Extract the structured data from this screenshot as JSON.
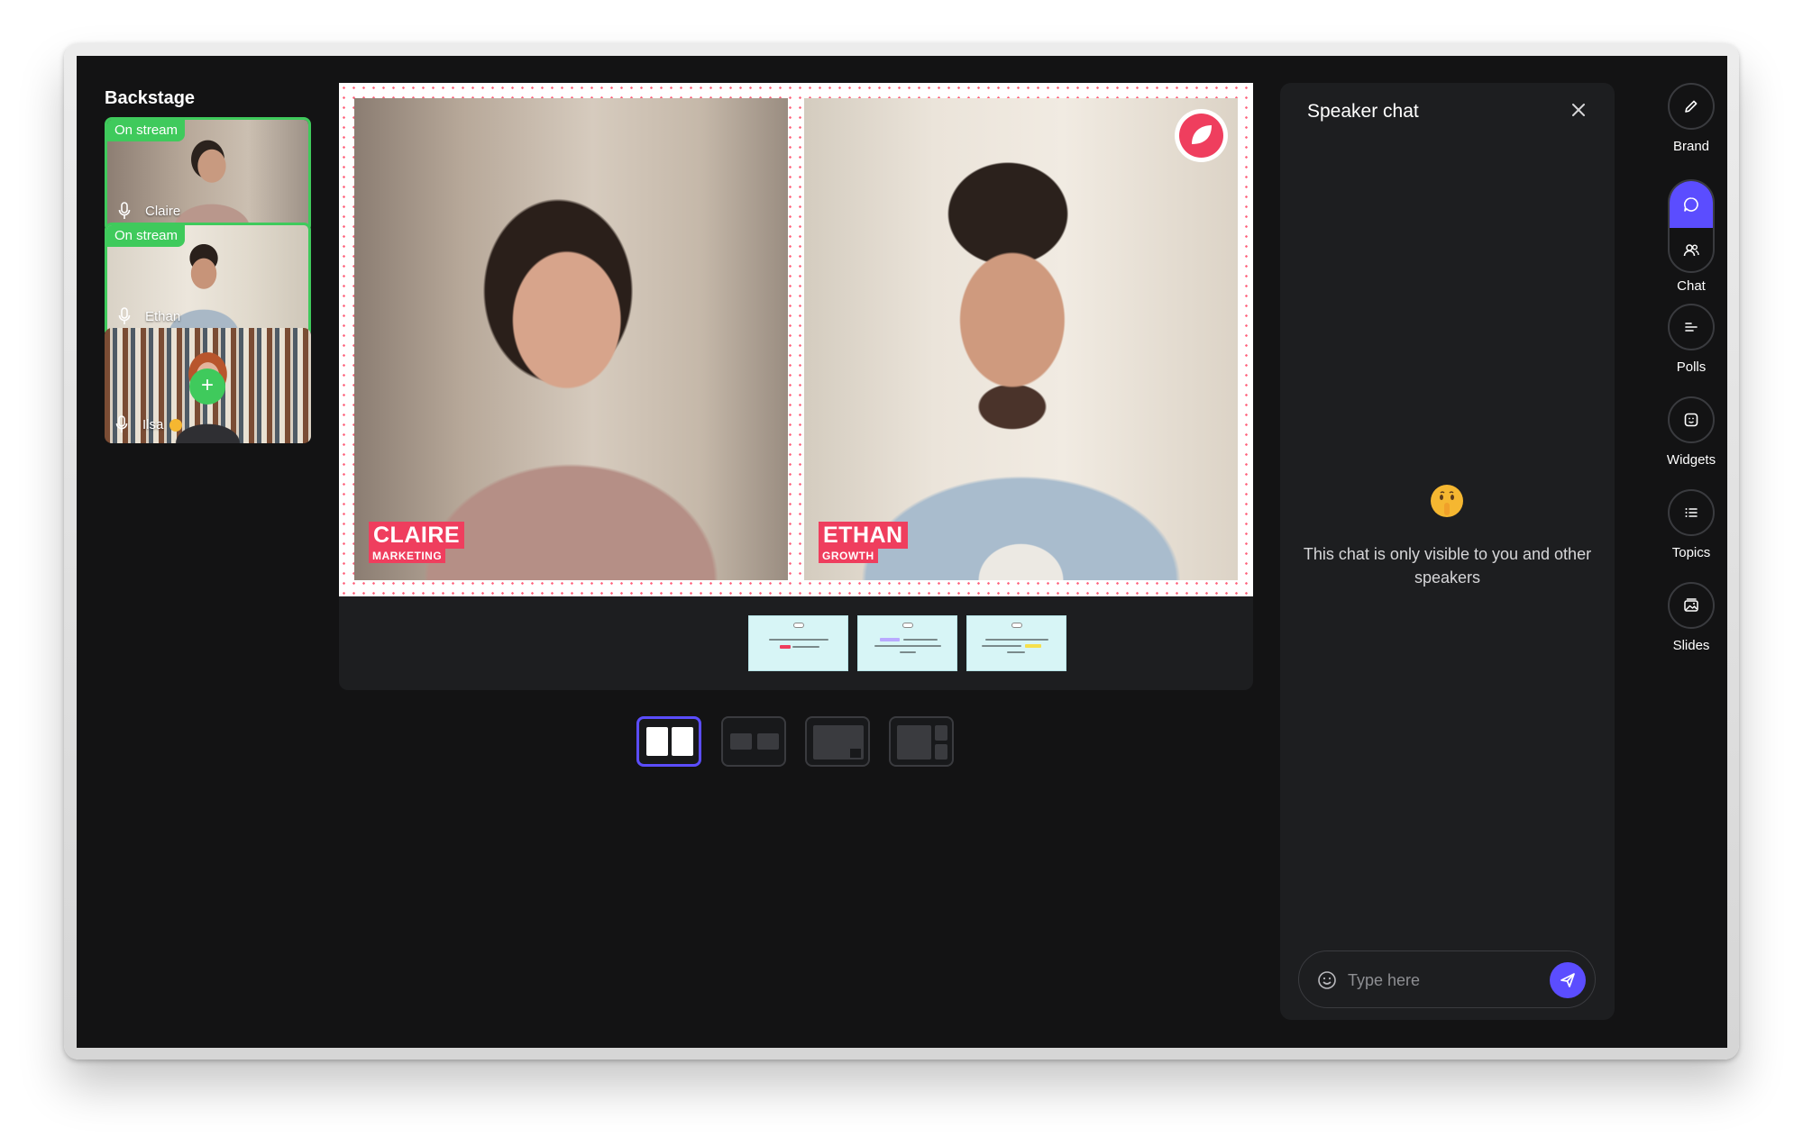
{
  "backstage": {
    "title": "Backstage",
    "participants": [
      {
        "name": "Claire",
        "badge": "On stream",
        "status": "on-stream"
      },
      {
        "name": "Ethan",
        "badge": "On stream",
        "status": "on-stream"
      },
      {
        "name": "Ilsa",
        "badge": "",
        "status": "backstage",
        "add_label": "+"
      }
    ]
  },
  "stage": {
    "speakers": [
      {
        "name": "CLAIRE",
        "role": "MARKETING"
      },
      {
        "name": "ETHAN",
        "role": "GROWTH"
      }
    ],
    "slides_count": 3,
    "active_layout": "side-by-side"
  },
  "layouts": [
    "side-by-side",
    "small-pair",
    "picture-in-picture",
    "grid-sidebar"
  ],
  "chat": {
    "title": "Speaker chat",
    "empty_message": "This chat is only visible to you and other speakers",
    "input_placeholder": "Type here"
  },
  "rail": {
    "items": [
      {
        "label": "Brand",
        "icon": "pencil-icon"
      },
      {
        "label": "Chat",
        "icon": "chat-icon"
      },
      {
        "label": "Polls",
        "icon": "polls-icon"
      },
      {
        "label": "Widgets",
        "icon": "widgets-icon"
      },
      {
        "label": "Topics",
        "icon": "list-icon"
      },
      {
        "label": "Slides",
        "icon": "image-icon"
      }
    ]
  },
  "colors": {
    "accent": "#5b4dff",
    "on_stream": "#3fca5c",
    "brand_red": "#ef3e5e",
    "background": "#131314",
    "panel": "#1d1e20"
  }
}
